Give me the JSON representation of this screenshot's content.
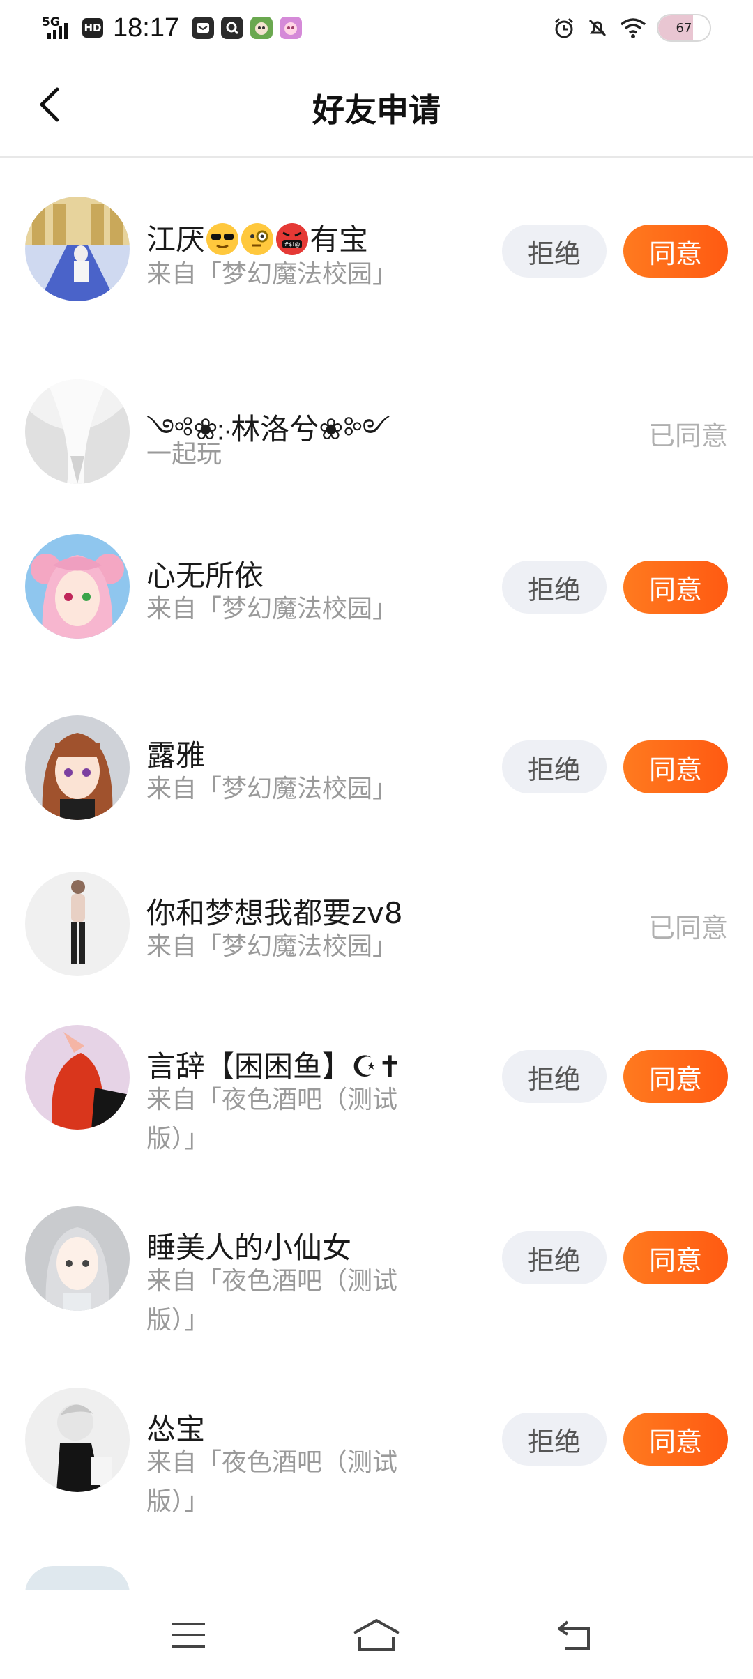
{
  "status_bar": {
    "network": "5G",
    "hd": "HD",
    "time": "18:17",
    "battery": "67",
    "battery_fraction": 0.67
  },
  "header": {
    "title": "好友申请"
  },
  "requests": [
    {
      "name_parts": [
        "江厌",
        "",
        "",
        "",
        "有宝"
      ],
      "source": "来自「梦幻魔法校园」",
      "status": "pending",
      "reject_label": "拒绝",
      "accept_label": "同意"
    },
    {
      "name": "༺❀჻林洛兮❀༻",
      "source": "一起玩",
      "status": "accepted",
      "status_label": "已同意"
    },
    {
      "name": "心无所依",
      "source": "来自「梦幻魔法校园」",
      "status": "pending",
      "reject_label": "拒绝",
      "accept_label": "同意"
    },
    {
      "name": "露雅",
      "source": "来自「梦幻魔法校园」",
      "status": "pending",
      "reject_label": "拒绝",
      "accept_label": "同意"
    },
    {
      "name": "你和梦想我都要zv8",
      "source": "来自「梦幻魔法校园」",
      "status": "accepted",
      "status_label": "已同意"
    },
    {
      "name": "言辞【困困鱼】☪✝",
      "source": "来自「夜色酒吧（测试版）」",
      "status": "pending",
      "reject_label": "拒绝",
      "accept_label": "同意"
    },
    {
      "name": "睡美人的小仙女",
      "source": "来自「夜色酒吧（测试版）」",
      "status": "pending",
      "reject_label": "拒绝",
      "accept_label": "同意"
    },
    {
      "name": "怂宝",
      "source": "来自「夜色酒吧（测试版）」",
      "status": "pending",
      "reject_label": "拒绝",
      "accept_label": "同意"
    }
  ],
  "colors": {
    "accent": "#ff6414",
    "reject_bg": "#eef0f5",
    "muted_text": "#9a9a9a"
  }
}
